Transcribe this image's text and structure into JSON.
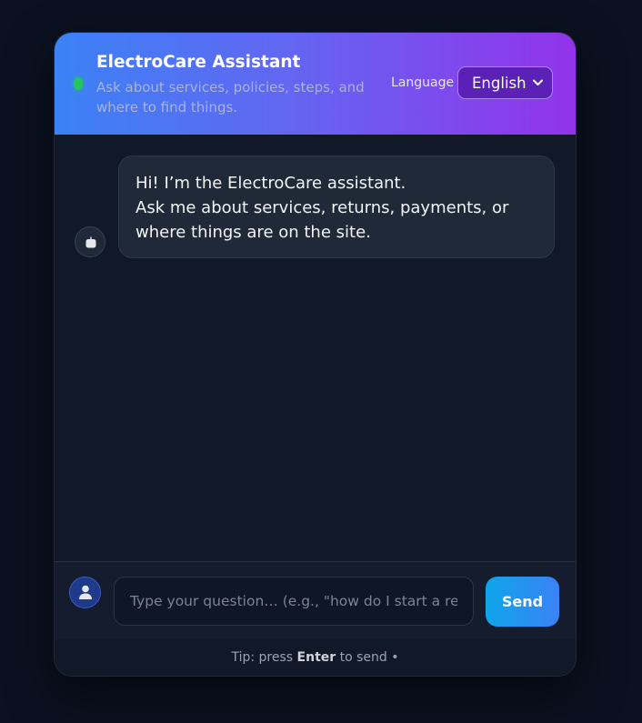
{
  "header": {
    "title": "ElectroCare Assistant",
    "subtitle": "Ask about services, policies, steps, and where to find things.",
    "status_color": "#22c55e",
    "language_label": "Language",
    "language_selected": "English",
    "gradient": [
      "#3b82f6",
      "#9333ea"
    ]
  },
  "messages": [
    {
      "sender": "bot",
      "avatar_icon": "robot-icon",
      "lines": [
        "Hi! I’m the ElectroCare assistant.",
        "Ask me about services, returns, payments, or",
        "where things are on the site."
      ]
    }
  ],
  "composer": {
    "avatar_icon": "user-icon",
    "placeholder": "Type your question… (e.g., \"how do I start a return?\")",
    "value": "",
    "send_label": "Send"
  },
  "footer": {
    "tip_prefix": "Tip: press",
    "tip_key": "Enter",
    "tip_suffix": "to send •"
  }
}
